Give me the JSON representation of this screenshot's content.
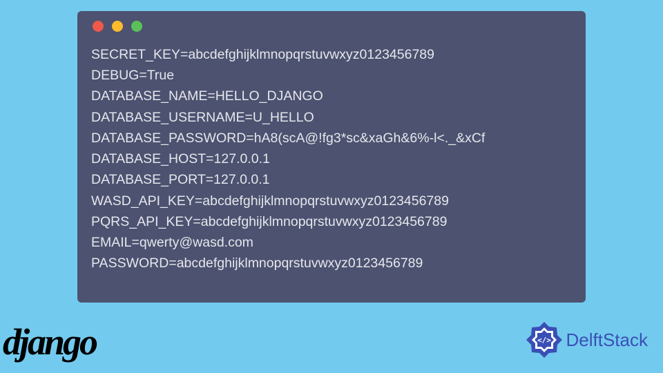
{
  "terminal": {
    "lines": [
      "SECRET_KEY=abcdefghijklmnopqrstuvwxyz0123456789",
      "DEBUG=True",
      "DATABASE_NAME=HELLO_DJANGO",
      "DATABASE_USERNAME=U_HELLO",
      "DATABASE_PASSWORD=hA8(scA@!fg3*sc&xaGh&6%-l<._&xCf",
      "DATABASE_HOST=127.0.0.1",
      "DATABASE_PORT=127.0.0.1",
      "WASD_API_KEY=abcdefghijklmnopqrstuvwxyz0123456789",
      "PQRS_API_KEY=abcdefghijklmnopqrstuvwxyz0123456789",
      "EMAIL=qwerty@wasd.com",
      "PASSWORD=abcdefghijklmnopqrstuvwxyz0123456789"
    ]
  },
  "logos": {
    "django": "django",
    "delftstack": "DelftStack"
  }
}
